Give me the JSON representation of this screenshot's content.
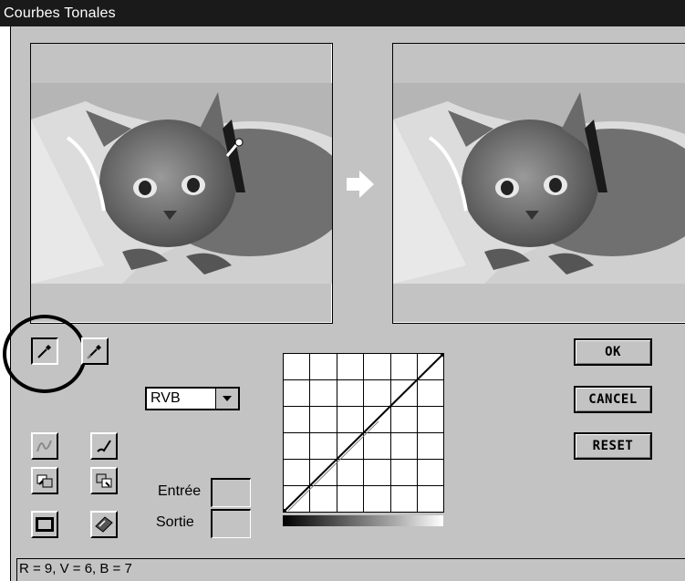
{
  "window": {
    "title": "Courbes Tonales"
  },
  "channel_select": {
    "value": "RVB"
  },
  "fields": {
    "input_label": "Entrée",
    "output_label": "Sortie"
  },
  "buttons": {
    "ok": "OK",
    "cancel": "CANCEL",
    "reset": "RESET"
  },
  "status": {
    "text": "R = 9, V = 6, B = 7"
  },
  "icons": {
    "tool_1": "eyedropper-icon",
    "tool_2": "eyedropper-secondary-icon",
    "curve_smooth": "freeform-curve-icon",
    "curve_pencil": "pencil-icon",
    "load": "load-curve-icon",
    "save": "save-curve-icon",
    "window": "window-icon",
    "help": "help-book-icon",
    "arrow": "right-arrow-icon"
  },
  "curve": {
    "points": [
      [
        0,
        0
      ],
      [
        255,
        255
      ]
    ]
  }
}
